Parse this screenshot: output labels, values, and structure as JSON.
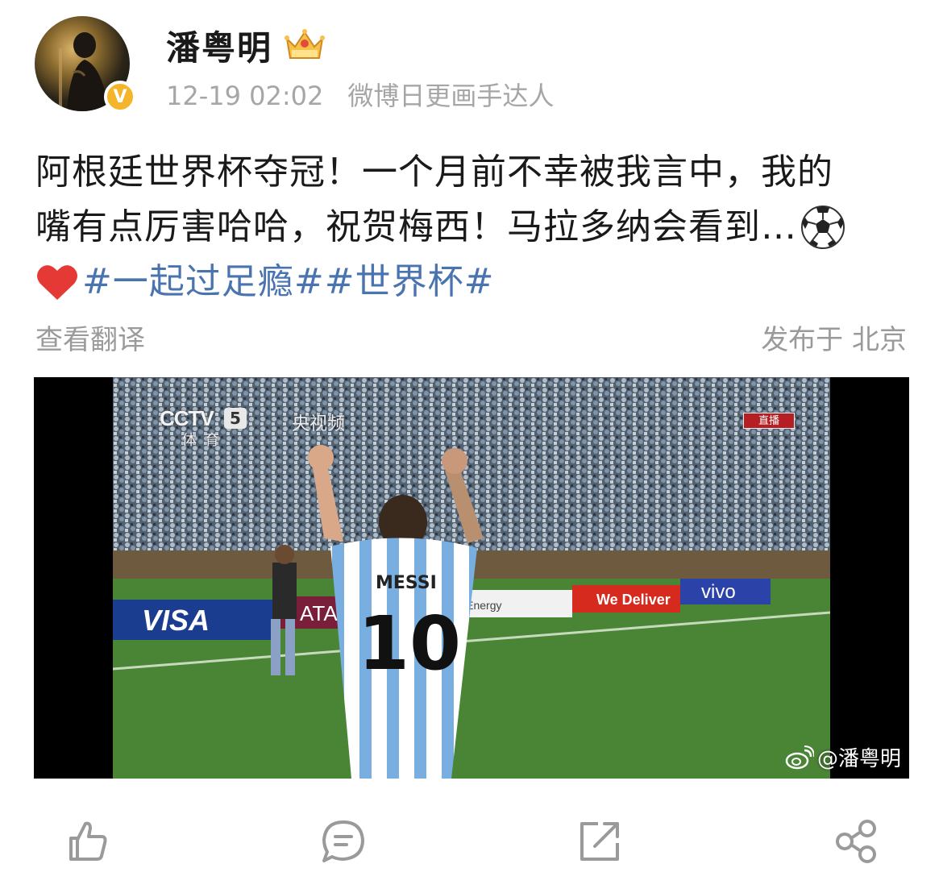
{
  "user": {
    "name": "潘粤明",
    "timestamp": "12-19 02:02",
    "source": "微博日更画手达人",
    "verified_mark": "V",
    "badge_icon": "crown-badge-icon"
  },
  "post": {
    "line1": "阿根廷世界杯夺冠！一个月前不幸被我言中，我的",
    "line2": "嘴有点厉害哈哈，祝贺梅西！马拉多纳会看到…",
    "hashtag1": "#一起过足瘾#",
    "hashtag2": "#世界杯#",
    "translate_label": "查看翻译",
    "location": "发布于 北京"
  },
  "video": {
    "channel": "CCTV",
    "channel_number": "5",
    "channel_sub": "体育",
    "app_name": "央视频",
    "live_badge": "直播",
    "jersey_name": "MESSI",
    "jersey_number": "10",
    "ads": [
      "VISA",
      "ATAR",
      "atarEnergy",
      "We Deliver",
      "vivo"
    ],
    "watermark": "@潘粤明"
  },
  "actions": [
    "like-icon",
    "comment-icon",
    "repost-icon",
    "share-icon"
  ],
  "colors": {
    "hashtag": "#4a74b0",
    "meta": "#a6a6a6",
    "verified": "#f5b52a",
    "pitch": "#4f8a3a"
  }
}
